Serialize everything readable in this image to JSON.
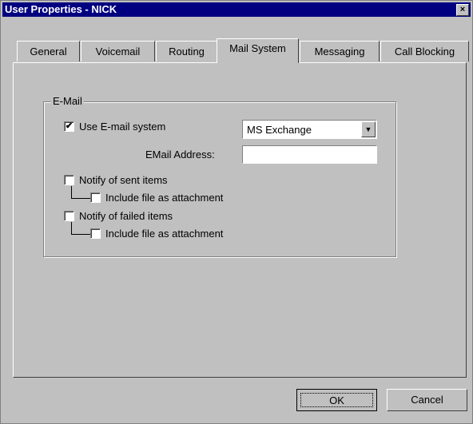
{
  "window": {
    "title": "User Properties - NICK",
    "close_glyph": "×"
  },
  "tabs": [
    {
      "label": "General",
      "active": false
    },
    {
      "label": "Voicemail",
      "active": false
    },
    {
      "label": "Routing",
      "active": false
    },
    {
      "label": "Mail System",
      "active": true
    },
    {
      "label": "Messaging",
      "active": false
    },
    {
      "label": "Call Blocking",
      "active": false
    }
  ],
  "email_group": {
    "label": "E-Mail",
    "use_email": {
      "label": "Use E-mail system",
      "checked": true
    },
    "mail_system": {
      "value": "MS Exchange",
      "arrow": "▼"
    },
    "address": {
      "label": "EMail Address:",
      "value": ""
    },
    "notify_sent": {
      "label": "Notify of sent items",
      "checked": false
    },
    "sent_attach": {
      "label": "Include file as attachment",
      "checked": false
    },
    "notify_failed": {
      "label": "Notify of failed items",
      "checked": false
    },
    "failed_attach": {
      "label": "Include file as attachment",
      "checked": false
    }
  },
  "buttons": {
    "ok": "OK",
    "cancel": "Cancel"
  },
  "colors": {
    "face": "#c0c0c0",
    "titlebar": "#000080"
  }
}
